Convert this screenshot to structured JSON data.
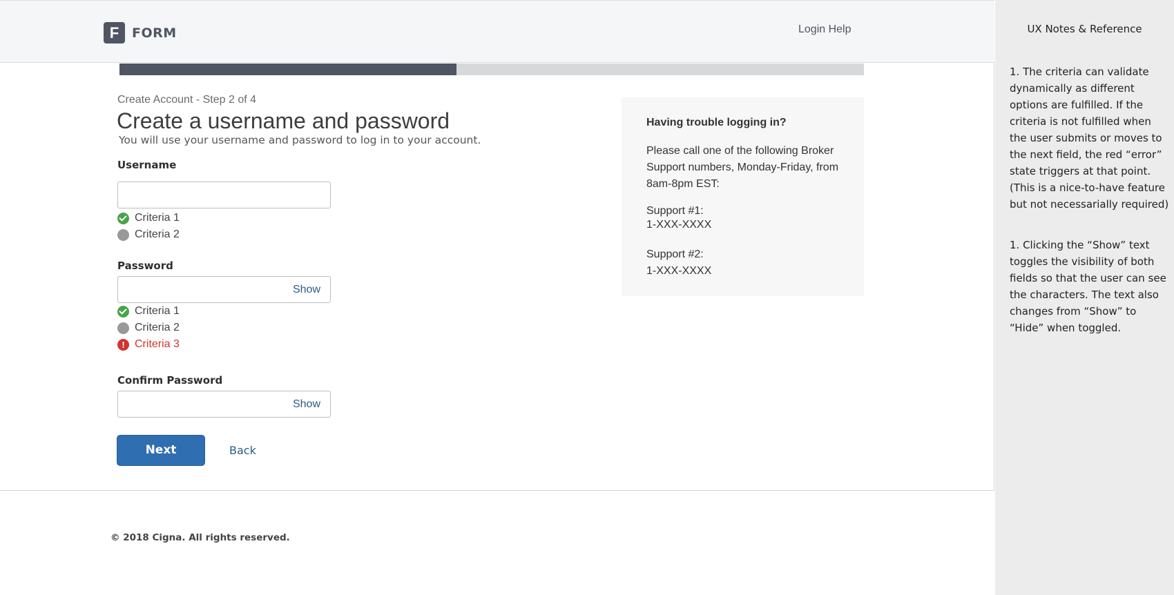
{
  "header": {
    "logo_letter": "F",
    "logo_text": "FORM",
    "login_help": "Login Help"
  },
  "progress": {
    "fraction": 0.453
  },
  "form": {
    "step_label": "Create Account - Step 2 of 4",
    "title": "Create a username and password",
    "subtitle": "You will use your username and password to log in to your account.",
    "username": {
      "label": "Username",
      "value": "",
      "criteria": [
        {
          "label": "Criteria 1",
          "state": "valid"
        },
        {
          "label": "Criteria 2",
          "state": "neutral"
        }
      ]
    },
    "password": {
      "label": "Password",
      "value": "",
      "show_label": "Show",
      "criteria": [
        {
          "label": "Criteria 1",
          "state": "valid"
        },
        {
          "label": "Criteria 2",
          "state": "neutral"
        },
        {
          "label": "Criteria 3",
          "state": "error"
        }
      ]
    },
    "confirm_password": {
      "label": "Confirm Password",
      "value": "",
      "show_label": "Show"
    },
    "next_label": "Next",
    "back_label": "Back"
  },
  "help": {
    "title": "Having trouble logging in?",
    "body": "Please call one of the following Broker Support numbers, Monday-Friday, from 8am-8pm EST:",
    "support": [
      {
        "label": "Support #1:",
        "number": "1-XXX-XXXX"
      },
      {
        "label": "Support #2:",
        "number": "1-XXX-XXXX"
      }
    ]
  },
  "footer": {
    "copyright": "© 2018 Cigna. All rights reserved."
  },
  "notes": {
    "title": "UX Notes & Reference",
    "items": [
      "1. The criteria can validate dynamically as different options are fulfilled. If the criteria is not fulfilled when the user submits or moves to the next field, the red “error” state triggers at that point. (This is a nice-to-have feature but not necessarially required)",
      "1. Clicking the “Show” text toggles the visibility of both fields so that the user can see the characters. The text also changes from “Show” to “Hide” when toggled."
    ]
  },
  "colors": {
    "brand": "#4f5562",
    "primary_button": "#2f6eb0",
    "link": "#2d5b86",
    "valid": "#4aa34a",
    "neutral": "#999999",
    "error": "#d0352e"
  }
}
